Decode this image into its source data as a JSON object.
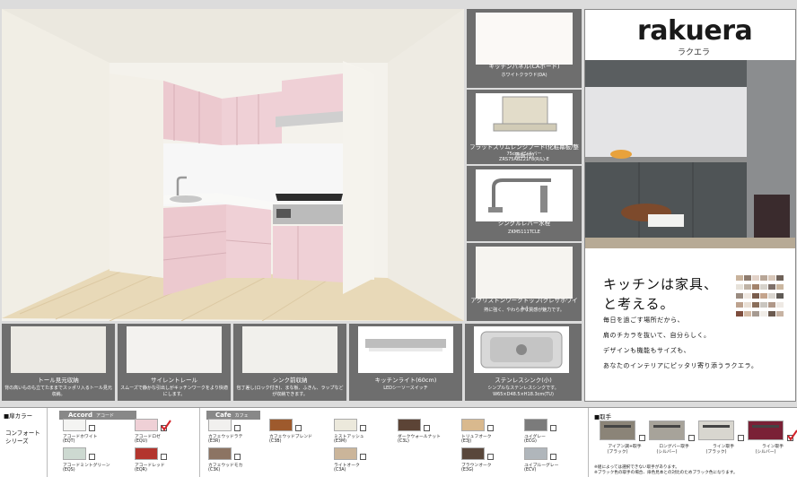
{
  "specs": [
    {
      "title": "キッチンパネル(CAボード)",
      "code": "ホワイトクラウド(DA)"
    },
    {
      "title": "フラットスリムレンジフード(化粧幕板/整流板付)",
      "code": "75cm／シルバー",
      "code2": "ZRS75ABZ21F8(R/L)-E"
    },
    {
      "title": "シングルレバー水栓",
      "code": "ZKM5111TCLE"
    },
    {
      "title": "アクリストンワークトップ(クレサホワイト)",
      "code": "熱に強く、やわらかな質感が魅力です。"
    }
  ],
  "brand": {
    "logo": "rakuera",
    "kana": "ラクエラ",
    "headline1": "キッチンは家具、",
    "headline2": "と考える。",
    "body": [
      "毎日を過ごす場所だから、",
      "肩のチカラを抜いて、自分らしく。",
      "デザインも機能もサイズも、",
      "あなたのインテリアにピッタリ寄り添うラクエラ。"
    ]
  },
  "features": [
    {
      "title": "トール見元収納",
      "desc": "背の高いものも立てたままでスッポリ入るトール見元収納。"
    },
    {
      "title": "サイレントレール",
      "desc": "スムーズで静かな引出しがキッチンワークをより快適にします。"
    },
    {
      "title": "シンク前収納",
      "desc": "包丁差し(ロック付き)、まな板、ふきん、ラップなどが収納できます。"
    },
    {
      "title": "キッチンライト(60cm)",
      "desc": "LEDシーソースイッチ"
    },
    {
      "title": "ステンレスシンク(小)",
      "desc": "シンプルなステンレスシンクです。W65×D48.5×H18.3cm(TU)"
    }
  ],
  "doors": {
    "section_label": "■扉カラー",
    "series_label": "コンフォート シリーズ",
    "accord": {
      "name": "Accord",
      "kana": "アコード"
    },
    "cafe": {
      "name": "Cafe",
      "kana": "カフェ"
    },
    "swatches": [
      {
        "name": "アコードホワイト",
        "code": "(EQT)",
        "color": "#f4f4f2",
        "checked": false
      },
      {
        "name": "アコードロゼ",
        "code": "(EQU)",
        "color": "#efd0d6",
        "checked": true
      },
      {
        "name": "アコードミントグリーン",
        "code": "(EQS)",
        "color": "#cdd9d1",
        "checked": false
      },
      {
        "name": "アコードレッド",
        "code": "(EQR)",
        "color": "#b3352e",
        "checked": false
      },
      {
        "name": "カフェウッドラテ",
        "code": "(E3R)",
        "color": "#f1f0ee",
        "checked": false
      },
      {
        "name": "カフェウッドブレンド",
        "code": "(C3B)",
        "color": "#9e5a2d",
        "checked": false
      },
      {
        "name": "ミストアッシュ",
        "code": "(E3M)",
        "color": "#ece9dc",
        "checked": false
      },
      {
        "name": "ダークウォールナット",
        "code": "(C3L)",
        "color": "#5c4436",
        "checked": false
      },
      {
        "name": "トリュフオーク",
        "code": "(E3J)",
        "color": "#d9b98e",
        "checked": false
      },
      {
        "name": "ユイグレー",
        "code": "(ECG)",
        "color": "#7b7b7b",
        "checked": false
      },
      {
        "name": "カフェウッドモカ",
        "code": "(C3K)",
        "color": "#8c7463",
        "checked": false
      },
      {
        "name": "ライトオーク",
        "code": "(C3A)",
        "color": "#cbb59a",
        "checked": false
      },
      {
        "name": "ブラウンオーク",
        "code": "(E3G)",
        "color": "#59473b",
        "checked": false
      },
      {
        "name": "ユイブルーグレー",
        "code": "(ECV)",
        "color": "#b0b6bb",
        "checked": false
      }
    ]
  },
  "handles": {
    "label": "■取手",
    "items": [
      {
        "name": "アイアン調+取手",
        "code": "(ブラック)",
        "checked": false
      },
      {
        "name": "ロングバー取手",
        "code": "(シルバー)",
        "checked": false
      },
      {
        "name": "ライン取手",
        "code": "(ブラック)",
        "checked": false
      },
      {
        "name": "ライン取手",
        "code": "(シルバー)",
        "checked": true
      }
    ],
    "note1": "※組によっては選択できない取手があります。",
    "note2": "※ブラック色の取手の場合、扉色見本との対比のためブラック色になります。"
  }
}
